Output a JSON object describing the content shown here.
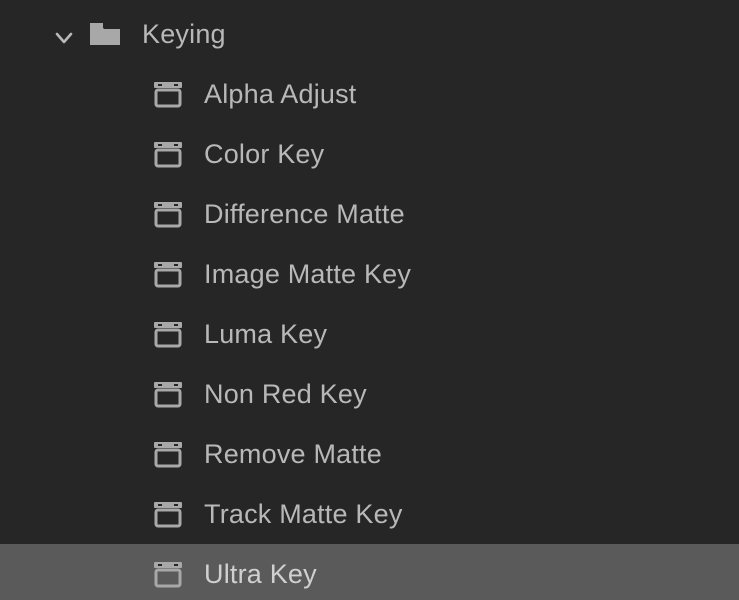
{
  "folder": {
    "name": "Keying",
    "expanded": true,
    "items": [
      {
        "label": "Alpha Adjust",
        "selected": false
      },
      {
        "label": "Color Key",
        "selected": false
      },
      {
        "label": "Difference Matte",
        "selected": false
      },
      {
        "label": "Image Matte Key",
        "selected": false
      },
      {
        "label": "Luma Key",
        "selected": false
      },
      {
        "label": "Non Red Key",
        "selected": false
      },
      {
        "label": "Remove Matte",
        "selected": false
      },
      {
        "label": "Track Matte Key",
        "selected": false
      },
      {
        "label": "Ultra Key",
        "selected": true
      }
    ]
  }
}
